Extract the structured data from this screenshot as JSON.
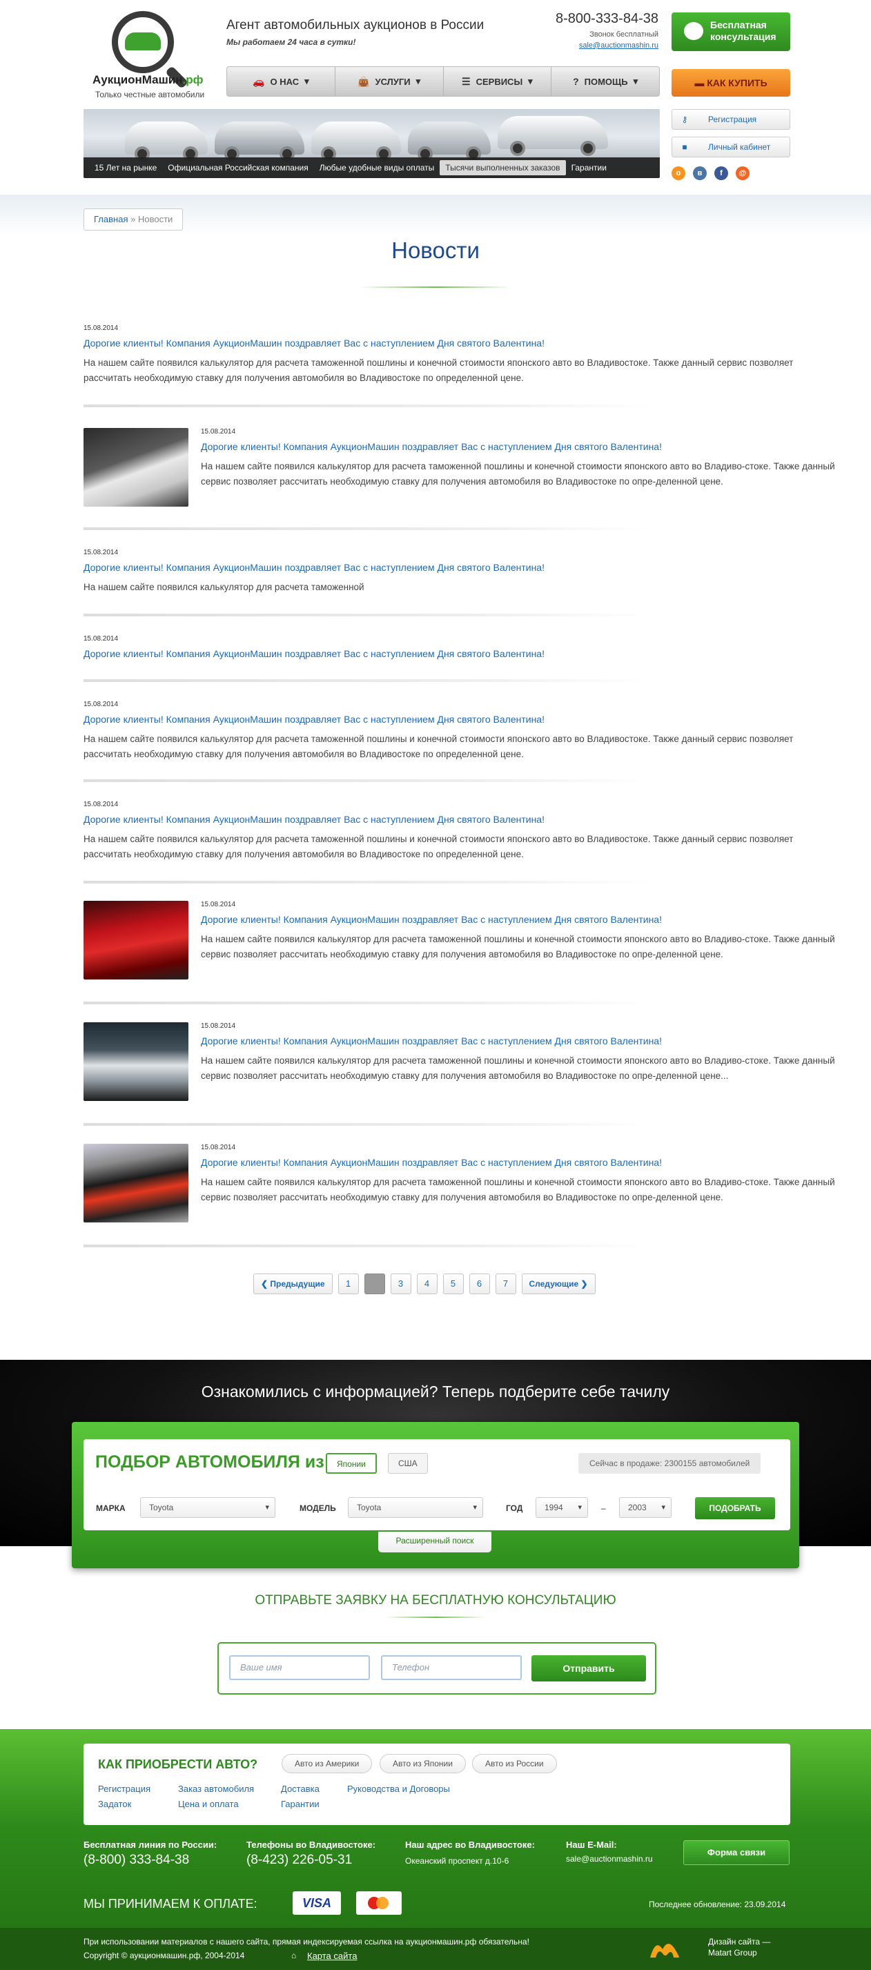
{
  "header": {
    "logo_name_main": "АукционМашин",
    "logo_name_tld": ".рф",
    "logo_sub": "Только честные автомобили",
    "agent": "Агент автомобильных аукционов в России",
    "work_hours": "Мы работаем 24 часа в сутки!",
    "phone": "8-800-333-84-38",
    "free_call": "Звонок бесплатный",
    "email": "sale@auctionmashin.ru",
    "consult_btn": "Бесплатная консультация",
    "howbuy_btn": "КАК КУПИТЬ",
    "register_btn": "Регистрация",
    "cabinet_btn": "Личный кабинет",
    "nav": [
      {
        "label": "О НАС",
        "icon": "car-icon",
        "glyph": "🚗"
      },
      {
        "label": "УСЛУГИ",
        "icon": "bag-icon",
        "glyph": "👜"
      },
      {
        "label": "СЕРВИСЫ",
        "icon": "list-icon",
        "glyph": "☰"
      },
      {
        "label": "ПОМОЩЬ",
        "icon": "help-icon",
        "glyph": "?"
      }
    ],
    "banner_tabs": [
      "15 Лет на рынке",
      "Официальная Российская компания",
      "Любые удобные виды оплаты",
      "Тысячи выполненных заказов",
      "Гарантии"
    ],
    "banner_active": 3,
    "social": [
      {
        "name": "odnoklassniki-icon",
        "glyph": "о",
        "color": "#f7931e"
      },
      {
        "name": "vk-icon",
        "glyph": "в",
        "color": "#4c75a3"
      },
      {
        "name": "facebook-icon",
        "glyph": "f",
        "color": "#3b5998"
      },
      {
        "name": "mailru-icon",
        "glyph": "@",
        "color": "#f26522"
      }
    ]
  },
  "breadcrumb": {
    "home": "Главная",
    "sep": "»",
    "current": "Новости"
  },
  "page_title": "Новости",
  "news": [
    {
      "date": "15.08.2014",
      "title": "Дорогие клиенты! Компания АукционМашин поздравляет Вас с наступлением Дня святого Валентина!",
      "text": "На нашем сайте появился калькулятор для расчета таможенной пошлины и конечной стоимости японского авто во Владивостоке. Также данный сервис позволяет рассчитать необходимую ставку для получения автомобиля во Владивостоке по определенной цене."
    },
    {
      "date": "15.08.2014",
      "title": "Дорогие клиенты! Компания АукционМашин поздравляет Вас с наступлением Дня святого Валентина!",
      "text": "На нашем сайте появился калькулятор для расчета таможенной пошлины и конечной стоимости японского авто во Владиво-стоке. Также данный сервис позволяет рассчитать необходимую ставку для получения автомобиля во Владивостоке по опре-деленной цене.",
      "thumb": "white-car"
    },
    {
      "date": "15.08.2014",
      "title": "Дорогие клиенты! Компания АукционМашин поздравляет Вас с наступлением Дня святого Валентина!",
      "text": "На нашем сайте появился калькулятор для расчета таможенной"
    },
    {
      "date": "15.08.2014",
      "title": "Дорогие клиенты! Компания АукционМашин поздравляет Вас с наступлением Дня святого Валентина!",
      "text": ""
    },
    {
      "date": "15.08.2014",
      "title": "Дорогие клиенты! Компания АукционМашин поздравляет Вас с наступлением Дня святого Валентина!",
      "text": "На нашем сайте появился калькулятор для расчета таможенной пошлины и конечной стоимости японского авто во Владивостоке. Также данный сервис позволяет рассчитать необходимую ставку для получения автомобиля во Владивостоке по определенной цене."
    },
    {
      "date": "15.08.2014",
      "title": "Дорогие клиенты! Компания АукционМашин поздравляет Вас с наступлением Дня святого Валентина!",
      "text": "На нашем сайте появился калькулятор для расчета таможенной пошлины и конечной стоимости японского авто во Владивостоке. Также данный сервис позволяет рассчитать необходимую ставку для получения автомобиля во Владивостоке по определенной цене."
    },
    {
      "date": "15.08.2014",
      "title": "Дорогие клиенты! Компания АукционМашин поздравляет Вас с наступлением Дня святого Валентина!",
      "text": "На нашем сайте появился калькулятор для расчета таможенной пошлины и конечной стоимости японского авто во Владиво-стоке. Также данный сервис позволяет рассчитать необходимую ставку для получения автомобиля во Владивостоке по опре-деленной цене.",
      "thumb": "red-car"
    },
    {
      "date": "15.08.2014",
      "title": "Дорогие клиенты! Компания АукционМашин поздравляет Вас с наступлением Дня святого Валентина!",
      "text": "На нашем сайте появился калькулятор для расчета таможенной пошлины и конечной стоимости японского авто во Владиво-стоке. Также данный сервис позволяет рассчитать необходимую ставку для получения автомобиля во Владивостоке по опре-деленной цене...",
      "thumb": "silver-cars"
    },
    {
      "date": "15.08.2014",
      "title": "Дорогие клиенты! Компания АукционМашин поздравляет Вас с наступлением Дня святого Валентина!",
      "text": "На нашем сайте появился калькулятор для расчета таможенной пошлины и конечной стоимости японского авто во Владиво-стоке. Также данный сервис позволяет рассчитать необходимую ставку для получения автомобиля во Владивостоке по опре-деленной цене.",
      "thumb": "black-red-car"
    }
  ],
  "pager": {
    "prev": "Предыдущие",
    "next": "Следующие",
    "pages": [
      "1",
      "2",
      "3",
      "4",
      "5",
      "6",
      "7"
    ],
    "current": "2"
  },
  "selector": {
    "banner_title": "Ознакомились с информацией? Теперь подберите себе тачилу",
    "title": "ПОДБОР АВТОМОБИЛЯ из",
    "countries": [
      "Японии",
      "США"
    ],
    "active_country": "Японии",
    "on_sale": "Сейчас в продаже: 2300155 автомобилей",
    "make_label": "МАРКА",
    "make_value": "Toyota",
    "model_label": "МОДЕЛЬ",
    "model_value": "Toyota",
    "year_label": "ГОД",
    "year_from": "1994",
    "year_dash": "–",
    "year_to": "2003",
    "find_btn": "ПОДОБРАТЬ",
    "advanced": "Расширенный поиск"
  },
  "consult": {
    "title": "ОТПРАВЬТЕ ЗАЯВКУ НА БЕСПЛАТНУЮ КОНСУЛЬТАЦИЮ",
    "name_placeholder": "Ваше имя",
    "phone_placeholder": "Телефон",
    "send_btn": "Отправить"
  },
  "footer": {
    "how_title": "КАК ПРИОБРЕСТИ АВТО?",
    "pills": [
      "Авто из Америки",
      "Авто из Японии",
      "Авто из России"
    ],
    "links_row1": [
      "Регистрация",
      "Заказ автомобиля",
      "Доставка",
      "Руководства и Договоры"
    ],
    "links_row2": [
      "Задаток",
      "Цена и оплата",
      "Гарантии"
    ],
    "free_line_label": "Бесплатная линия по России:",
    "free_line_value": "(8-800) 333-84-38",
    "vlad_phone_label": "Телефоны во Владивостоке:",
    "vlad_phone_value": "(8-423) 226-05-31",
    "address_label": "Наш адрес во Владивостоке:",
    "address_value": "Океанский проспект д.10-6",
    "email_label": "Наш E-Mail:",
    "email_value": "sale@auctionmashin.ru",
    "form_btn": "Форма связи",
    "pay_label": "МЫ ПРИНИМАЕМ К ОПЛАТЕ:",
    "visa": "VISA",
    "updated": "Последнее обновление: 23.09.2014",
    "copy1": "При использовании материалов с нашего сайта, прямая индексируемая ссылка на аукционмашин.рф обязательна!",
    "copy2": "Copyright © аукционмашин.рф, 2004-2014",
    "sitemap": "Карта сайта",
    "design1": "Дизайн сайта —",
    "design2": "Matart Group"
  }
}
